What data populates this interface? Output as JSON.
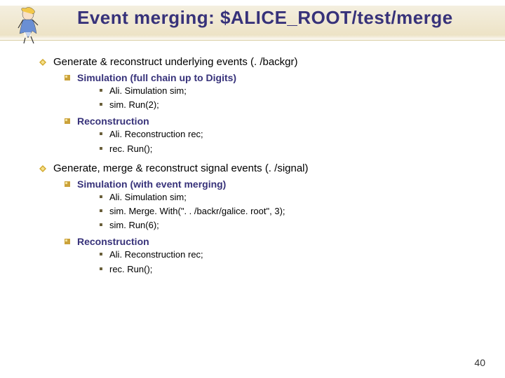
{
  "title": "Event merging: $ALICE_ROOT/test/merge",
  "sections": [
    {
      "heading": "Generate & reconstruct underlying events (. /backgr)",
      "subs": [
        {
          "heading": "Simulation (full chain up to Digits)",
          "lines": [
            "Ali. Simulation sim;",
            "sim. Run(2);"
          ]
        },
        {
          "heading": "Reconstruction",
          "lines": [
            "Ali. Reconstruction rec;",
            "rec. Run();"
          ]
        }
      ]
    },
    {
      "heading": "Generate, merge & reconstruct signal events (. /signal)",
      "subs": [
        {
          "heading": "Simulation (with event merging)",
          "lines": [
            "Ali. Simulation sim;",
            "sim. Merge. With(\". . /backr/galice. root\", 3);",
            "sim. Run(6);"
          ]
        },
        {
          "heading": "Reconstruction",
          "lines": [
            "Ali. Reconstruction rec;",
            "rec. Run();"
          ]
        }
      ]
    }
  ],
  "page_number": "40"
}
